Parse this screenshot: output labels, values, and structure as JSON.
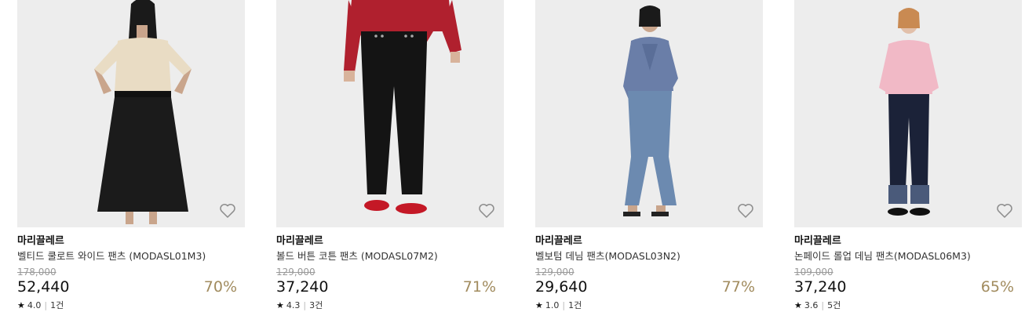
{
  "products": [
    {
      "brand": "마리끌레르",
      "name": "벨티드 쿨로트 와이드 팬츠 (MODASL01M3)",
      "original_price": "178,000",
      "price": "52,440",
      "discount": "70%",
      "rating": "4.0",
      "reviews": "1건",
      "wishlisted": false
    },
    {
      "brand": "마리끌레르",
      "name": "볼드 버튼 코튼 팬츠 (MODASL07M2)",
      "original_price": "129,000",
      "price": "37,240",
      "discount": "71%",
      "rating": "4.3",
      "reviews": "3건",
      "wishlisted": false
    },
    {
      "brand": "마리끌레르",
      "name": "벨보텀 데님 팬츠(MODASL03N2)",
      "original_price": "129,000",
      "price": "29,640",
      "discount": "77%",
      "rating": "1.0",
      "reviews": "1건",
      "wishlisted": false
    },
    {
      "brand": "마리끌레르",
      "name": "논페이드 롤업 데님 팬츠(MODASL06M3)",
      "original_price": "109,000",
      "price": "37,240",
      "discount": "65%",
      "rating": "3.6",
      "reviews": "5건",
      "wishlisted": false
    }
  ],
  "icons": {
    "wishlist": "heart-outline-icon",
    "rating": "star-icon"
  },
  "colors": {
    "discount": "#a18b5e",
    "strike_price": "#9a9a9a",
    "image_bg": "#ededed"
  }
}
